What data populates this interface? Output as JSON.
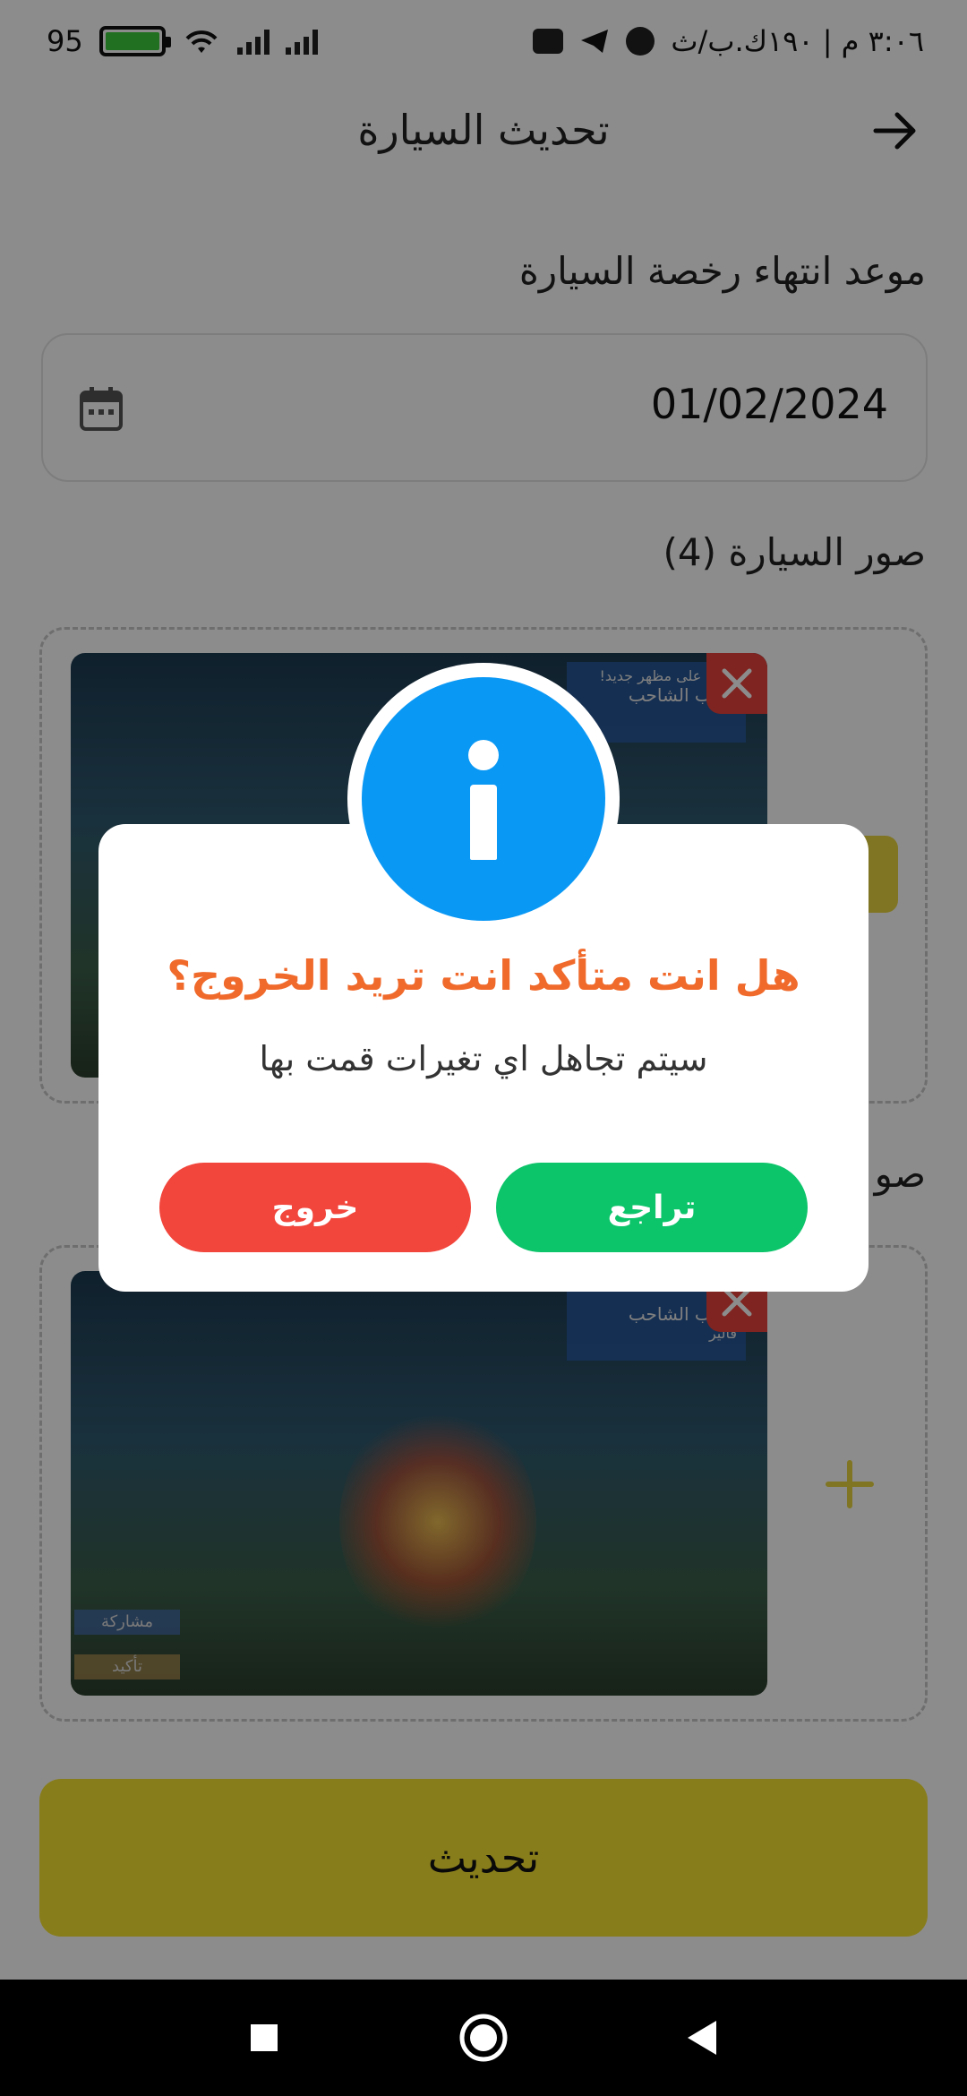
{
  "status_bar": {
    "battery": "95",
    "time": "٣:٠٦ م | ١٩٠ك.ب/ث"
  },
  "header": {
    "title": "تحديث السيارة"
  },
  "form": {
    "license_label": "موعد انتهاء رخصة السيارة",
    "license_date": "01/02/2024",
    "photos_label": "صور السيارة (4)",
    "second_section_label": "صو"
  },
  "photo": {
    "banner_top": "صلت على مظهر جديد!",
    "banner_name": "اللهب الشاحب",
    "banner_sub": "فالير",
    "tag_share": "مشاركة",
    "tag_confirm": "تأكيد"
  },
  "update_button": "تحديث",
  "dialog": {
    "title": "هل انت متأكد انت تريد الخروج؟",
    "message": "سيتم تجاهل اي تغيرات قمت بها",
    "back_label": "تراجع",
    "exit_label": "خروج"
  },
  "colors": {
    "accent": "#f8e332",
    "info": "#0a98f5",
    "confirm": "#0cc46a",
    "danger": "#f2453b",
    "title": "#f06a2c"
  }
}
